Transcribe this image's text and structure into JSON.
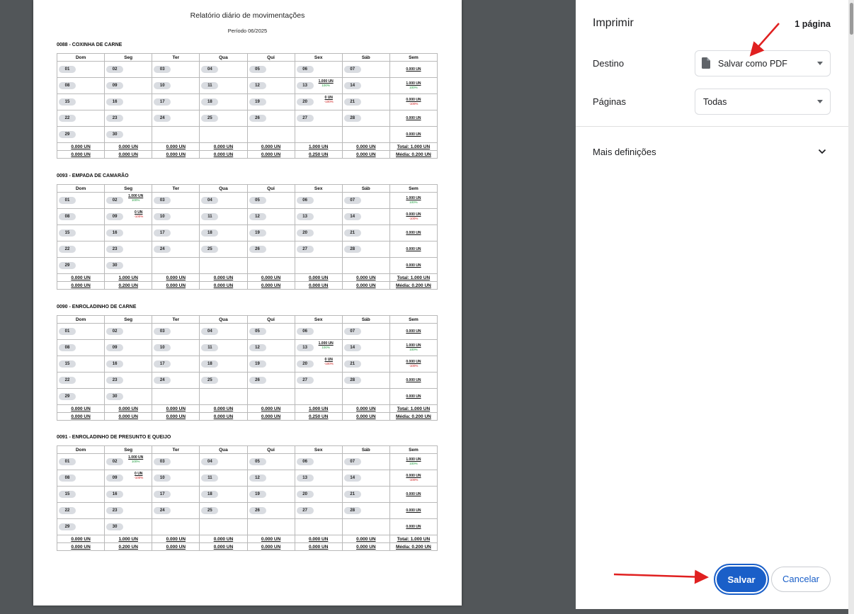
{
  "report": {
    "title": "Relatório diário de movimentações",
    "period": "Período 06/2025",
    "weekdays": [
      "Dom",
      "Seg",
      "Ter",
      "Qua",
      "Qui",
      "Sex",
      "Sáb",
      "Sem"
    ],
    "products": [
      {
        "name": "0088 - COXINHA DE CARNE",
        "cells": {
          "13": [
            "1.000 UN",
            "100%",
            "g"
          ],
          "20": [
            "0 UN",
            "-100%",
            "r"
          ]
        },
        "sem": [
          [
            "0.000 UN",
            "",
            ""
          ],
          [
            "1.000 UN",
            "100%",
            "g"
          ],
          [
            "0.000 UN",
            "-100%",
            "r"
          ],
          [
            "0.000 UN",
            "",
            ""
          ],
          [
            "0.000 UN",
            "",
            ""
          ]
        ],
        "row1": [
          "0.000 UN",
          "0.000 UN",
          "0.000 UN",
          "0.000 UN",
          "0.000 UN",
          "1.000 UN",
          "0.000 UN",
          "Total: 1.000 UN"
        ],
        "row2": [
          "0.000 UN",
          "0.000 UN",
          "0.000 UN",
          "0.000 UN",
          "0.000 UN",
          "0.250 UN",
          "0.000 UN",
          "Média: 0.200 UN"
        ]
      },
      {
        "name": "0093 - EMPADA DE CAMARÃO",
        "cells": {
          "02": [
            "1.000 UN",
            "100%",
            "g"
          ],
          "09": [
            "0 UN",
            "-100%",
            "r"
          ]
        },
        "sem": [
          [
            "1.000 UN",
            "100%",
            "g"
          ],
          [
            "0.000 UN",
            "-100%",
            "r"
          ],
          [
            "0.000 UN",
            "",
            ""
          ],
          [
            "0.000 UN",
            "",
            ""
          ],
          [
            "0.000 UN",
            "",
            ""
          ]
        ],
        "row1": [
          "0.000 UN",
          "1.000 UN",
          "0.000 UN",
          "0.000 UN",
          "0.000 UN",
          "0.000 UN",
          "0.000 UN",
          "Total: 1.000 UN"
        ],
        "row2": [
          "0.000 UN",
          "0.200 UN",
          "0.000 UN",
          "0.000 UN",
          "0.000 UN",
          "0.000 UN",
          "0.000 UN",
          "Média: 0.200 UN"
        ]
      },
      {
        "name": "0090 - ENROLADINHO DE CARNE",
        "cells": {
          "13": [
            "1.000 UN",
            "100%",
            "g"
          ],
          "20": [
            "0 UN",
            "-100%",
            "r"
          ]
        },
        "sem": [
          [
            "0.000 UN",
            "",
            ""
          ],
          [
            "1.000 UN",
            "100%",
            "g"
          ],
          [
            "0.000 UN",
            "-100%",
            "r"
          ],
          [
            "0.000 UN",
            "",
            ""
          ],
          [
            "0.000 UN",
            "",
            ""
          ]
        ],
        "row1": [
          "0.000 UN",
          "0.000 UN",
          "0.000 UN",
          "0.000 UN",
          "0.000 UN",
          "1.000 UN",
          "0.000 UN",
          "Total: 1.000 UN"
        ],
        "row2": [
          "0.000 UN",
          "0.000 UN",
          "0.000 UN",
          "0.000 UN",
          "0.000 UN",
          "0.250 UN",
          "0.000 UN",
          "Média: 0.200 UN"
        ]
      },
      {
        "name": "0091 - ENROLADINHO DE PRESUNTO E QUEIJO",
        "cells": {
          "02": [
            "1.000 UN",
            "100%",
            "g"
          ],
          "09": [
            "0 UN",
            "-100%",
            "r"
          ]
        },
        "sem": [
          [
            "1.000 UN",
            "100%",
            "g"
          ],
          [
            "0.000 UN",
            "-100%",
            "r"
          ],
          [
            "0.000 UN",
            "",
            ""
          ],
          [
            "0.000 UN",
            "",
            ""
          ],
          [
            "0.000 UN",
            "",
            ""
          ]
        ],
        "row1": [
          "0.000 UN",
          "1.000 UN",
          "0.000 UN",
          "0.000 UN",
          "0.000 UN",
          "0.000 UN",
          "0.000 UN",
          "Total: 1.000 UN"
        ],
        "row2": [
          "0.000 UN",
          "0.200 UN",
          "0.000 UN",
          "0.000 UN",
          "0.000 UN",
          "0.000 UN",
          "0.000 UN",
          "Média: 0.200 UN"
        ]
      }
    ],
    "days": [
      [
        "01",
        "02",
        "03",
        "04",
        "05",
        "06",
        "07"
      ],
      [
        "08",
        "09",
        "10",
        "11",
        "12",
        "13",
        "14"
      ],
      [
        "15",
        "16",
        "17",
        "18",
        "19",
        "20",
        "21"
      ],
      [
        "22",
        "23",
        "24",
        "25",
        "26",
        "27",
        "28"
      ],
      [
        "29",
        "30",
        "",
        "",
        "",
        "",
        ""
      ]
    ]
  },
  "print_panel": {
    "title": "Imprimir",
    "page_count": "1 página",
    "destination_label": "Destino",
    "destination_value": "Salvar como PDF",
    "pages_label": "Páginas",
    "pages_value": "Todas",
    "more_settings": "Mais definições",
    "save_label": "Salvar",
    "cancel_label": "Cancelar"
  },
  "colors": {
    "accent": "#1a5fc8",
    "positive": "#1a9a3a",
    "negative": "#d02020",
    "annotation_arrow": "#e02020"
  },
  "icons": {
    "destination": "file-icon",
    "select_arrow": "dropdown-arrow-icon",
    "more_settings": "chevron-down-icon"
  }
}
